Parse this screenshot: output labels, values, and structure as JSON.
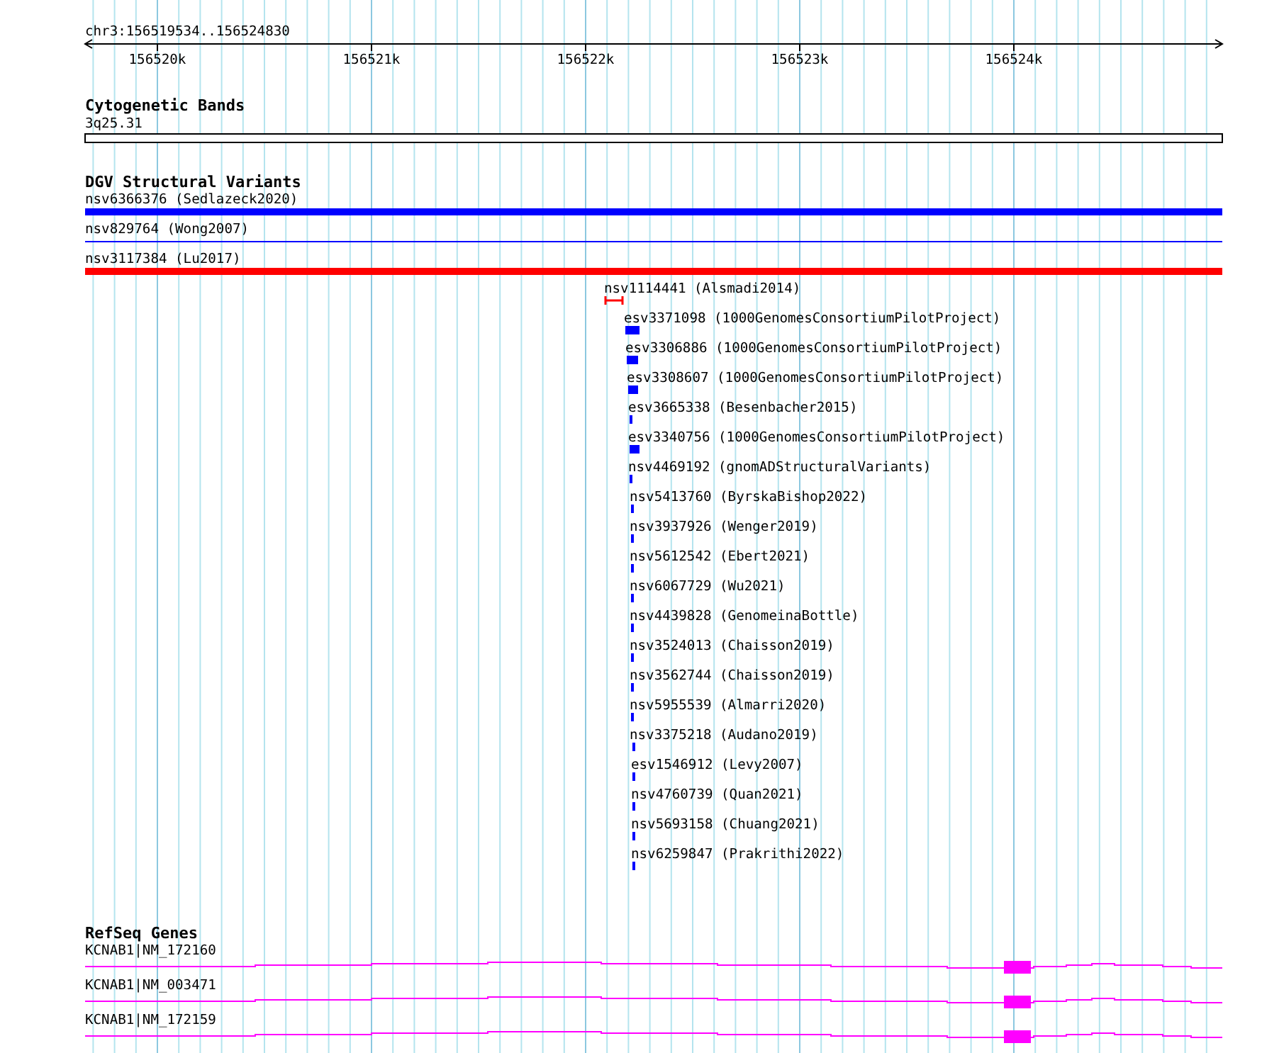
{
  "ruler": {
    "label": "chr3:156519534..156524830",
    "ticks": [
      "156520k",
      "156521k",
      "156522k",
      "156523k",
      "156524k"
    ]
  },
  "tracks": [
    {
      "kind": "cytoband",
      "title": "Cytogenetic Bands",
      "features": [
        {
          "label": "3q25.31"
        }
      ]
    },
    {
      "kind": "variants",
      "title": "DGV Structural Variants",
      "features": [
        {
          "label": "nsv6366376 (Sedlazeck2020)",
          "kind": "bar",
          "color": "#0000ff"
        },
        {
          "label": "nsv829764 (Wong2007)",
          "kind": "line",
          "color": "#0000ff"
        },
        {
          "label": "nsv3117384 (Lu2017)",
          "kind": "bar",
          "color": "#ff0000"
        },
        {
          "label": "nsv1114441 (Alsmadi2014)",
          "kind": "interval",
          "color": "#ff0000"
        },
        {
          "label": "esv3371098 (1000GenomesConsortiumPilotProject)",
          "kind": "bar",
          "color": "#0000ff"
        },
        {
          "label": "esv3306886 (1000GenomesConsortiumPilotProject)",
          "kind": "bar",
          "color": "#0000ff"
        },
        {
          "label": "esv3308607 (1000GenomesConsortiumPilotProject)",
          "kind": "bar",
          "color": "#0000ff"
        },
        {
          "label": "esv3665338 (Besenbacher2015)",
          "kind": "bar",
          "color": "#0000ff"
        },
        {
          "label": "esv3340756 (1000GenomesConsortiumPilotProject)",
          "kind": "bar",
          "color": "#0000ff"
        },
        {
          "label": "nsv4469192 (gnomADStructuralVariants)",
          "kind": "bar",
          "color": "#0000ff"
        },
        {
          "label": "nsv5413760 (ByrskaBishop2022)",
          "kind": "bar",
          "color": "#0000ff"
        },
        {
          "label": "nsv3937926 (Wenger2019)",
          "kind": "bar",
          "color": "#0000ff"
        },
        {
          "label": "nsv5612542 (Ebert2021)",
          "kind": "bar",
          "color": "#0000ff"
        },
        {
          "label": "nsv6067729 (Wu2021)",
          "kind": "bar",
          "color": "#0000ff"
        },
        {
          "label": "nsv4439828 (GenomeinaBottle)",
          "kind": "bar",
          "color": "#0000ff"
        },
        {
          "label": "nsv3524013 (Chaisson2019)",
          "kind": "bar",
          "color": "#0000ff"
        },
        {
          "label": "nsv3562744 (Chaisson2019)",
          "kind": "bar",
          "color": "#0000ff"
        },
        {
          "label": "nsv5955539 (Almarri2020)",
          "kind": "bar",
          "color": "#0000ff"
        },
        {
          "label": "nsv3375218 (Audano2019)",
          "kind": "bar",
          "color": "#0000ff"
        },
        {
          "label": "esv1546912 (Levy2007)",
          "kind": "bar",
          "color": "#0000ff"
        },
        {
          "label": "nsv4760739 (Quan2021)",
          "kind": "bar",
          "color": "#0000ff"
        },
        {
          "label": "nsv5693158 (Chuang2021)",
          "kind": "bar",
          "color": "#0000ff"
        },
        {
          "label": "nsv6259847 (Prakrithi2022)",
          "kind": "bar",
          "color": "#0000ff"
        }
      ]
    },
    {
      "kind": "genes",
      "title": "RefSeq Genes",
      "features": [
        {
          "label": "KCNAB1|NM_172160"
        },
        {
          "label": "KCNAB1|NM_003471"
        },
        {
          "label": "KCNAB1|NM_172159"
        }
      ]
    }
  ]
}
